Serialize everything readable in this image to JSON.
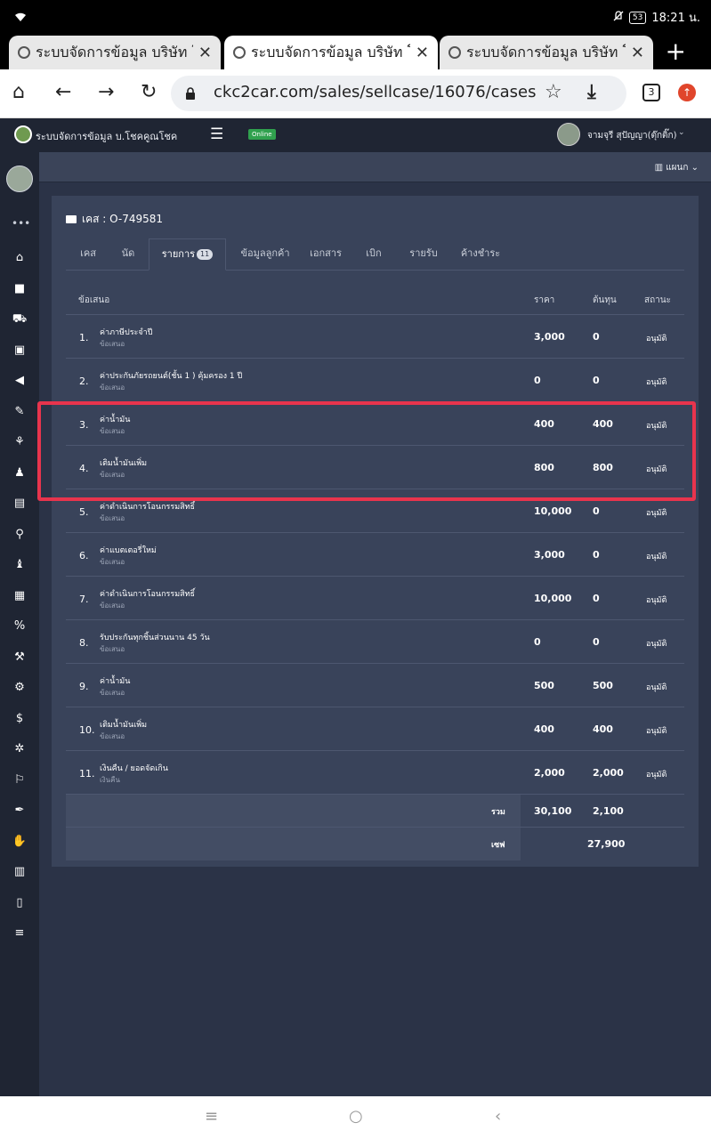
{
  "status_bar": {
    "time": "18:21 น.",
    "battery": "53"
  },
  "browser": {
    "tabs": [
      {
        "title": "ระบบจัดการข้อมูล บริษัท โ"
      },
      {
        "title": "ระบบจัดการข้อมูล บริษัท โ"
      },
      {
        "title": "ระบบจัดการข้อมูล บริษัท โ"
      }
    ],
    "new_tab": "+",
    "url": "ckc2car.com/sales/sellcase/16076/cases",
    "tab_count": "3"
  },
  "app": {
    "brand": "ระบบจัดการข้อมูล บ.โชคคูณโชค",
    "online_badge": "Online",
    "user_name": "จามจุรี สุปัญญา(ตุ๊กติ๊ก)",
    "plan_label": "แผนก",
    "sidebar_icons": [
      "home-icon",
      "car-icon",
      "cart-icon",
      "contact-card-icon",
      "megaphone-icon",
      "pen-icon",
      "tree-icon",
      "user-tie-icon",
      "cash-register-icon",
      "payment-icon",
      "user-money-icon",
      "calculator-icon",
      "percent-icon",
      "wrench-icon",
      "tools-icon",
      "dollar-icon",
      "gear-icon",
      "bookmark-icon",
      "feather-icon",
      "hand-icon",
      "newspaper-icon",
      "mobile-icon",
      "list-icon"
    ]
  },
  "case": {
    "title": "เคส : O-749581",
    "tabs": [
      {
        "label": "เคส"
      },
      {
        "label": "นัด"
      },
      {
        "label": "รายการ",
        "badge": "11"
      },
      {
        "label": "ข้อมูลลูกค้า"
      },
      {
        "label": "เอกสาร"
      },
      {
        "label": "เบิก"
      },
      {
        "label": "รายรับ"
      },
      {
        "label": "ค้างชำระ"
      }
    ],
    "headers": {
      "offer": "ข้อเสนอ",
      "price": "ราคา",
      "cost": "ต้นทุน",
      "status": "สถานะ"
    },
    "items": [
      {
        "no": "1.",
        "name": "ค่าภาษีประจำปี",
        "type": "ข้อเสนอ",
        "price": "3,000",
        "cost": "0",
        "status": "อนุมัติ"
      },
      {
        "no": "2.",
        "name": "ค่าประกันภัยรถยนต์(ชั้น 1 ) คุ้มครอง 1 ปี",
        "type": "ข้อเสนอ",
        "price": "0",
        "cost": "0",
        "status": "อนุมัติ"
      },
      {
        "no": "3.",
        "name": "ค่าน้ำมัน",
        "type": "ข้อเสนอ",
        "price": "400",
        "cost": "400",
        "status": "อนุมัติ"
      },
      {
        "no": "4.",
        "name": "เติมน้ำมันเพิ่ม",
        "type": "ข้อเสนอ",
        "price": "800",
        "cost": "800",
        "status": "อนุมัติ"
      },
      {
        "no": "5.",
        "name": "ค่าดำเนินการโอนกรรมสิทธิ์",
        "type": "ข้อเสนอ",
        "price": "10,000",
        "cost": "0",
        "status": "อนุมัติ"
      },
      {
        "no": "6.",
        "name": "ค่าแบตเตอรี่ใหม่",
        "type": "ข้อเสนอ",
        "price": "3,000",
        "cost": "0",
        "status": "อนุมัติ"
      },
      {
        "no": "7.",
        "name": "ค่าดำเนินการโอนกรรมสิทธิ์",
        "type": "ข้อเสนอ",
        "price": "10,000",
        "cost": "0",
        "status": "อนุมัติ"
      },
      {
        "no": "8.",
        "name": "รับประกันทุกชิ้นส่วนนาน 45 วัน",
        "type": "ข้อเสนอ",
        "price": "0",
        "cost": "0",
        "status": "อนุมัติ"
      },
      {
        "no": "9.",
        "name": "ค่าน้ำมัน",
        "type": "ข้อเสนอ",
        "price": "500",
        "cost": "500",
        "status": "อนุมัติ"
      },
      {
        "no": "10.",
        "name": "เติมน้ำมันเพิ่ม",
        "type": "ข้อเสนอ",
        "price": "400",
        "cost": "400",
        "status": "อนุมัติ"
      },
      {
        "no": "11.",
        "name": "เงินคืน / ยอดจัดเกิน",
        "type": "เงินคืน",
        "price": "2,000",
        "cost": "2,000",
        "status": "อนุมัติ"
      }
    ],
    "totals": {
      "sum_label": "รวม",
      "sum_price": "30,100",
      "sum_cost": "2,100",
      "net_label": "เซฟ",
      "net_value": "27,900"
    }
  },
  "colors": {
    "highlight": "#e8344d",
    "card": "#39435a",
    "nav": "#1f2533",
    "online": "#30a14e"
  }
}
